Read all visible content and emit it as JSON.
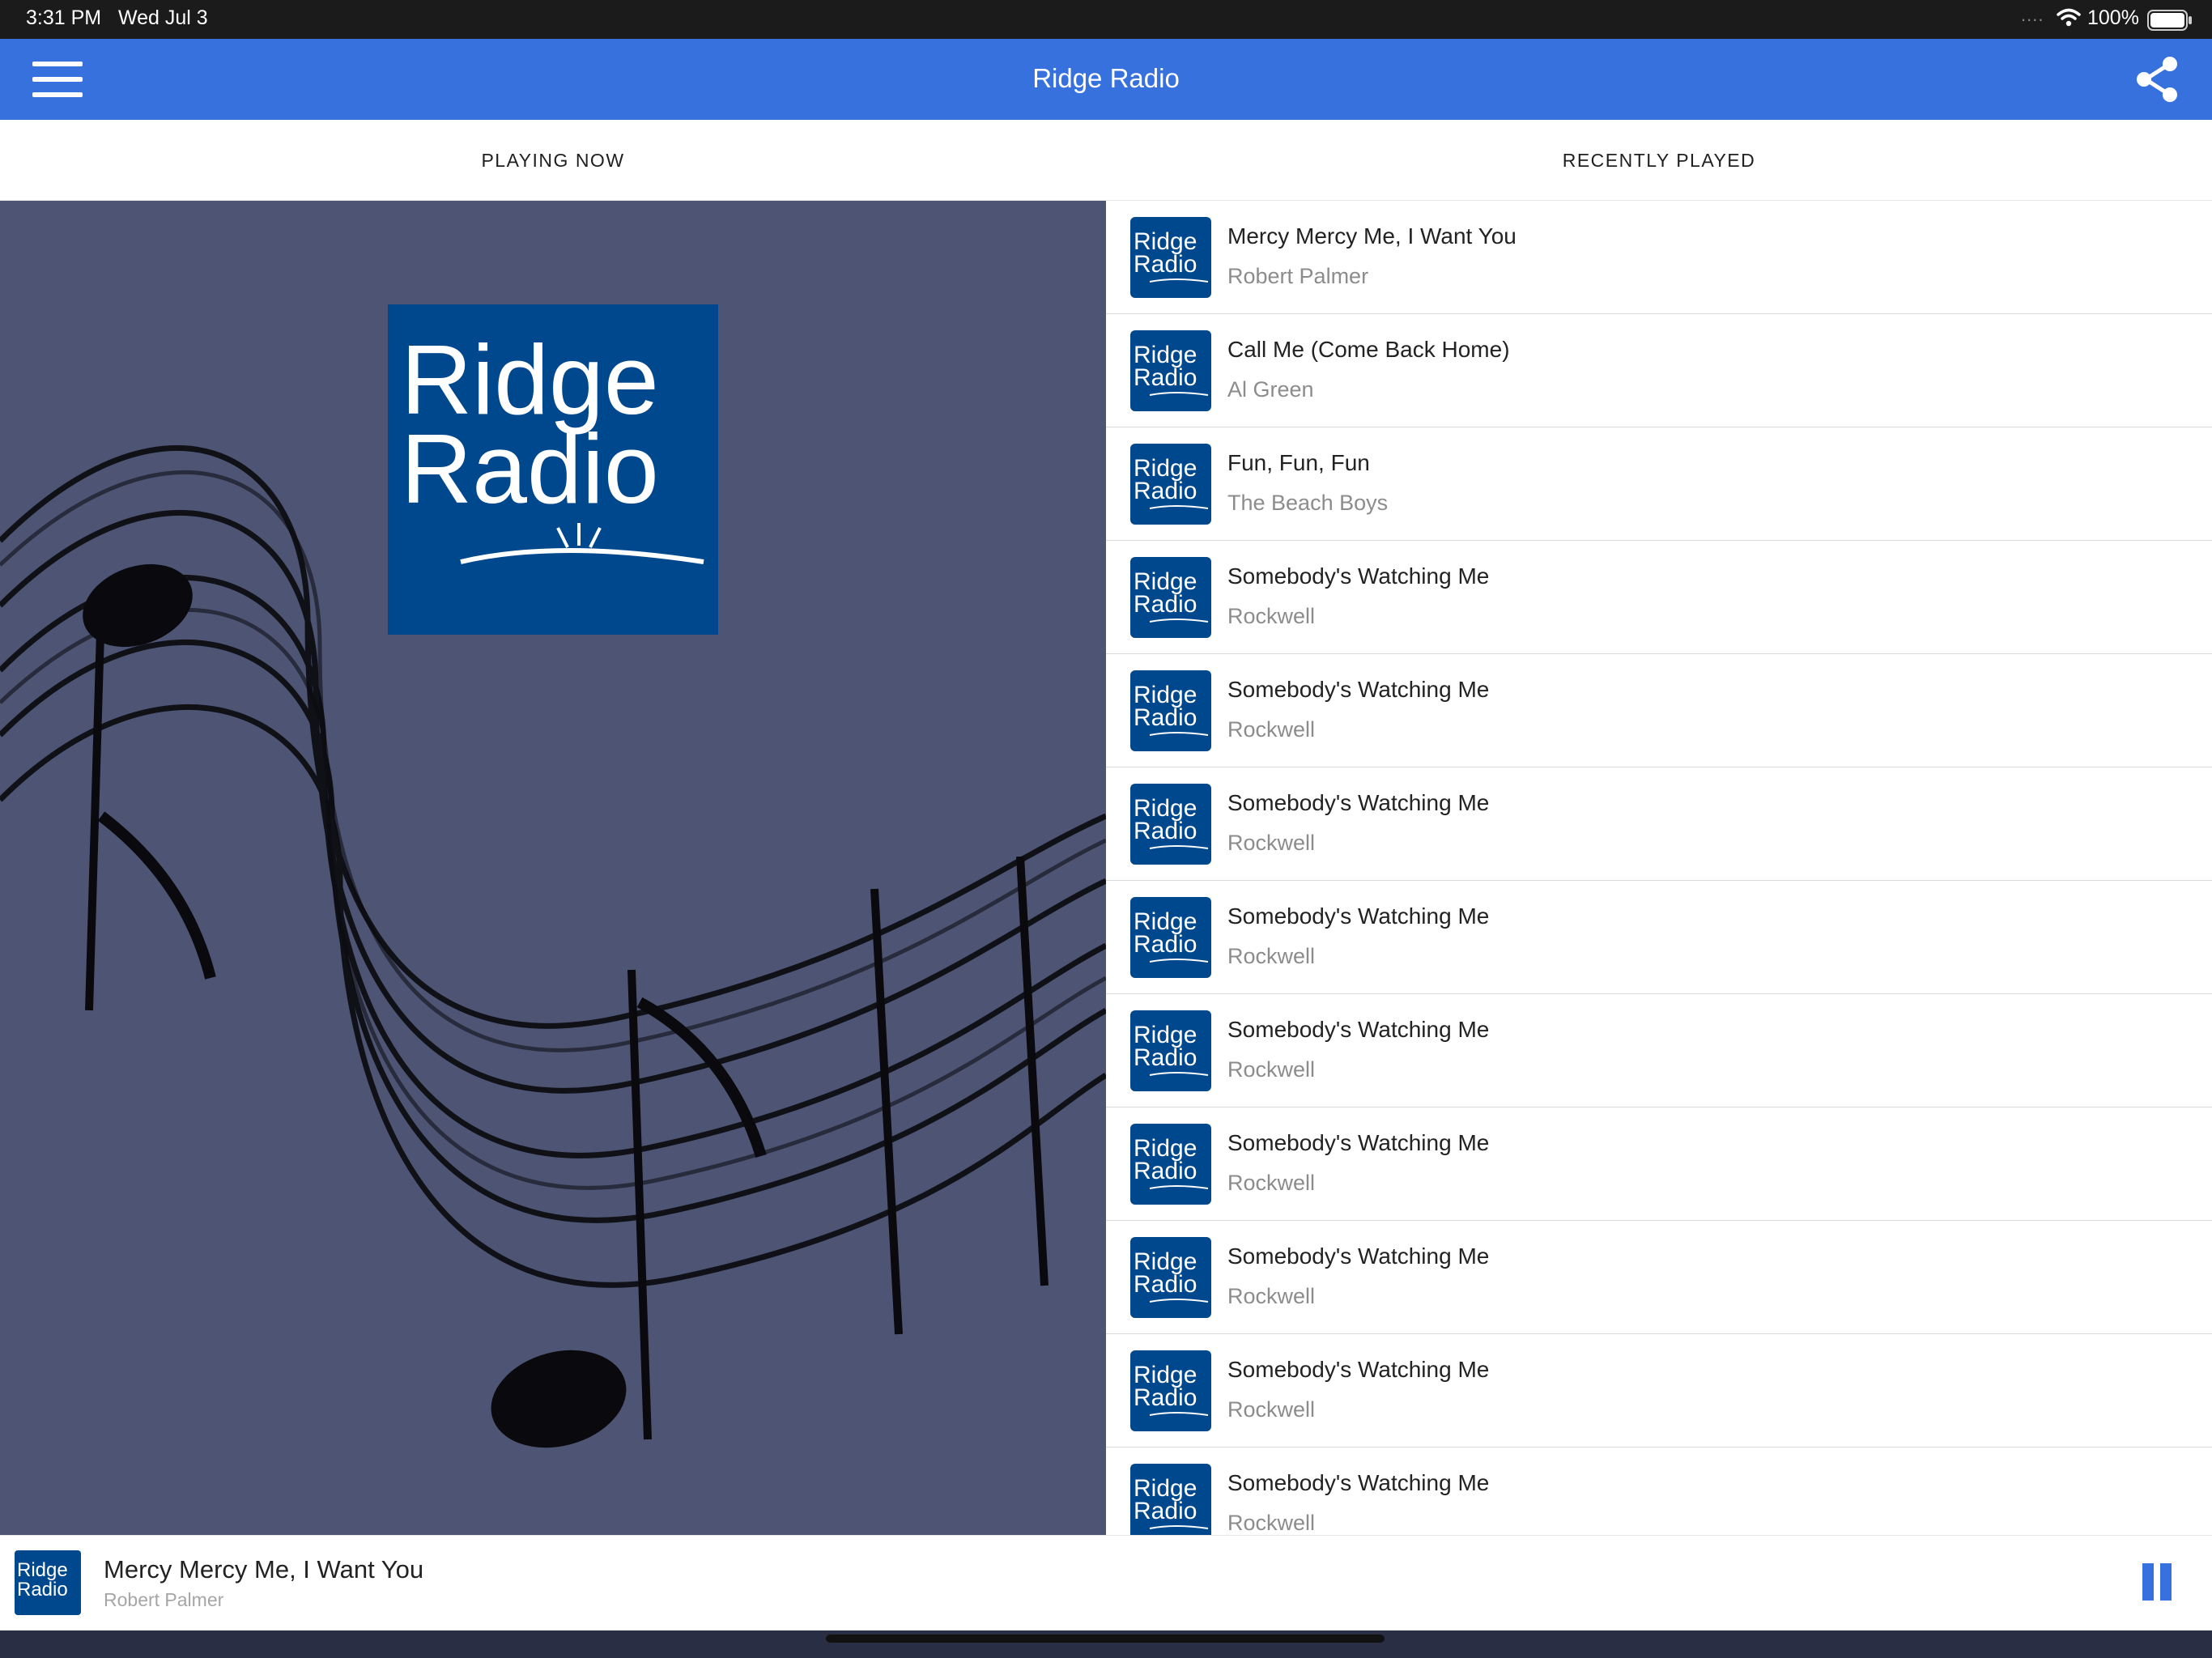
{
  "status_bar": {
    "time": "3:31 PM",
    "date": "Wed Jul 3",
    "signal_dots": "....",
    "battery_percent": "100%"
  },
  "header": {
    "title": "Ridge Radio",
    "menu_icon": "hamburger-menu-icon",
    "share_icon": "share-icon",
    "color": "#3771de"
  },
  "tabs": [
    {
      "label": "PLAYING NOW"
    },
    {
      "label": "RECENTLY PLAYED"
    }
  ],
  "logo": {
    "line1": "Ridge",
    "line2": "Radio",
    "color": "#00488e"
  },
  "recently_played": [
    {
      "title": "Mercy Mercy Me, I Want You",
      "artist": "Robert Palmer"
    },
    {
      "title": "Call Me (Come Back Home)",
      "artist": "Al Green"
    },
    {
      "title": "Fun, Fun, Fun",
      "artist": "The Beach Boys"
    },
    {
      "title": "Somebody's Watching Me",
      "artist": "Rockwell"
    },
    {
      "title": "Somebody's Watching Me",
      "artist": "Rockwell"
    },
    {
      "title": "Somebody's Watching Me",
      "artist": "Rockwell"
    },
    {
      "title": "Somebody's Watching Me",
      "artist": "Rockwell"
    },
    {
      "title": "Somebody's Watching Me",
      "artist": "Rockwell"
    },
    {
      "title": "Somebody's Watching Me",
      "artist": "Rockwell"
    },
    {
      "title": "Somebody's Watching Me",
      "artist": "Rockwell"
    },
    {
      "title": "Somebody's Watching Me",
      "artist": "Rockwell"
    },
    {
      "title": "Somebody's Watching Me",
      "artist": "Rockwell"
    }
  ],
  "mini_player": {
    "title": "Mercy Mercy Me, I Want You",
    "artist": "Robert Palmer",
    "pause_icon": "pause-icon"
  }
}
